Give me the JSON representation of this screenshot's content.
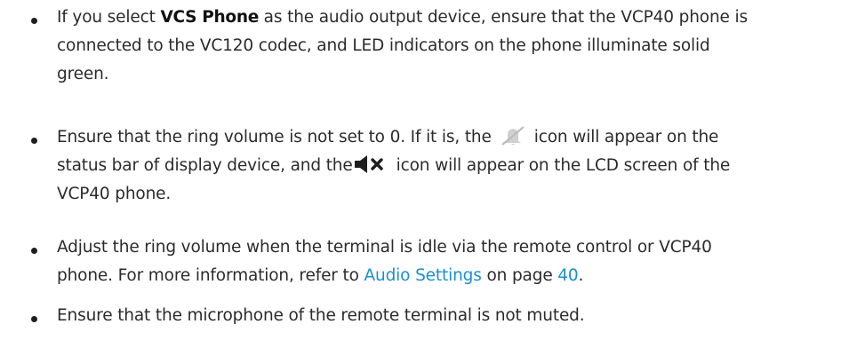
{
  "bullets": [
    {
      "lines": [
        {
          "before": "If you select ",
          "bold": "VCS Phone",
          "after": " as the audio output device, ensure that the VCP40 phone is"
        },
        {
          "text": "connected to the VC120 codec, and LED indicators on the phone illuminate solid"
        },
        {
          "text": "green."
        }
      ]
    },
    {
      "lines": [
        {
          "before": "Ensure that the ring volume is not set to 0. If it is, the",
          "after": "icon will appear on the",
          "icon": "muted-bell-icon"
        },
        {
          "before": "status bar of display device, and the",
          "after": "icon will appear on the LCD screen of the",
          "icon": "speaker-muted-icon"
        },
        {
          "text": "VCP40 phone."
        }
      ]
    },
    {
      "lines": [
        {
          "text": "Adjust the ring volume when the terminal is idle via the remote control or VCP40"
        },
        {
          "before": "phone. For more information, refer to ",
          "link": "Audio Settings",
          "middle": " on page ",
          "page": "40",
          "after": "."
        }
      ]
    },
    {
      "lines": [
        {
          "text": "Ensure that the microphone of the remote terminal is not muted."
        }
      ]
    }
  ],
  "colors": {
    "text": "#2b2b2b",
    "link": "#1a8fd1",
    "icon_gray": "#c8c8c8",
    "icon_dark": "#1e1e1e"
  }
}
